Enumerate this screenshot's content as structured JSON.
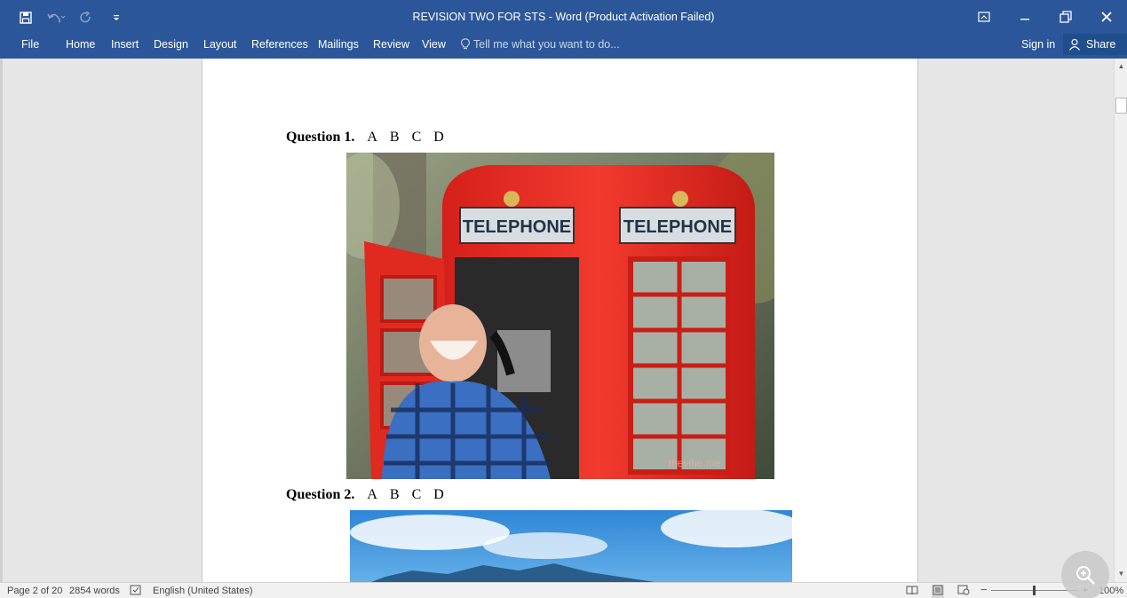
{
  "window": {
    "title": "REVISION TWO FOR STS - Word (Product Activation Failed)"
  },
  "ribbon": {
    "tabs": [
      "File",
      "Home",
      "Insert",
      "Design",
      "Layout",
      "References",
      "Mailings",
      "Review",
      "View"
    ],
    "tell_me_placeholder": "Tell me what you want to do...",
    "sign_in": "Sign in",
    "share": "Share"
  },
  "document": {
    "questions": [
      {
        "label": "Question 1.",
        "options": [
          "A",
          "B",
          "C",
          "D"
        ]
      },
      {
        "label": "Question 2.",
        "options": [
          "A",
          "B",
          "C",
          "D"
        ]
      }
    ],
    "photo1": {
      "sign_text": "TELEPHONE",
      "watermark": "thevibe.me"
    }
  },
  "statusbar": {
    "page": "Page 2 of 20",
    "words": "2854 words",
    "language": "English (United States)",
    "zoom": "100%"
  },
  "colors": {
    "accent": "#2b579a",
    "booth_red": "#e8261f"
  }
}
